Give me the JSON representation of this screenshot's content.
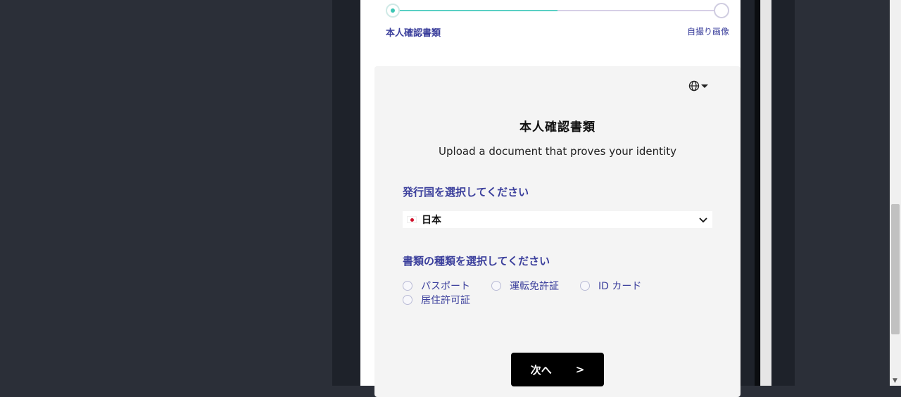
{
  "stepper": {
    "step1_label": "本人確認書類",
    "step2_label": "自撮り画像",
    "progress_percent": 50
  },
  "card": {
    "language_icon": "globe-icon",
    "title": "本人確認書類",
    "subtitle": "Upload a document that proves your identity",
    "country_label": "発行国を選択してください",
    "country_value": "日本",
    "doctype_label": "書類の種類を選択してください",
    "doc_options": [
      "パスポート",
      "運転免許証",
      "ID カード",
      "居住許可証"
    ],
    "next_label": "次へ",
    "next_arrow": ">"
  },
  "colors": {
    "accent_teal": "#3cc6b4",
    "label_indigo": "#3b3f9c",
    "button_bg": "#000000"
  }
}
